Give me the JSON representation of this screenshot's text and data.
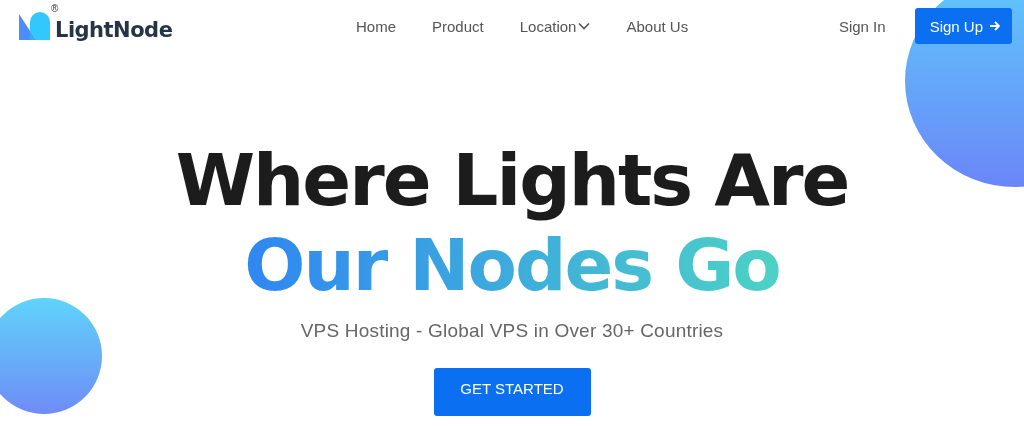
{
  "logo": {
    "name": "LightNode",
    "mark": "®"
  },
  "nav": {
    "links": [
      {
        "label": "Home",
        "kind": "link"
      },
      {
        "label": "Product",
        "kind": "link"
      },
      {
        "label": "Location",
        "kind": "dropdown"
      },
      {
        "label": "About Us",
        "kind": "link"
      }
    ],
    "sign_in": "Sign In",
    "sign_up": "Sign Up"
  },
  "hero": {
    "title_line_1": "Where Lights Are",
    "title_line_2": "Our Nodes Go",
    "subtitle": "VPS Hosting - Global VPS in Over 30+ Countries",
    "cta": "GET STARTED"
  }
}
